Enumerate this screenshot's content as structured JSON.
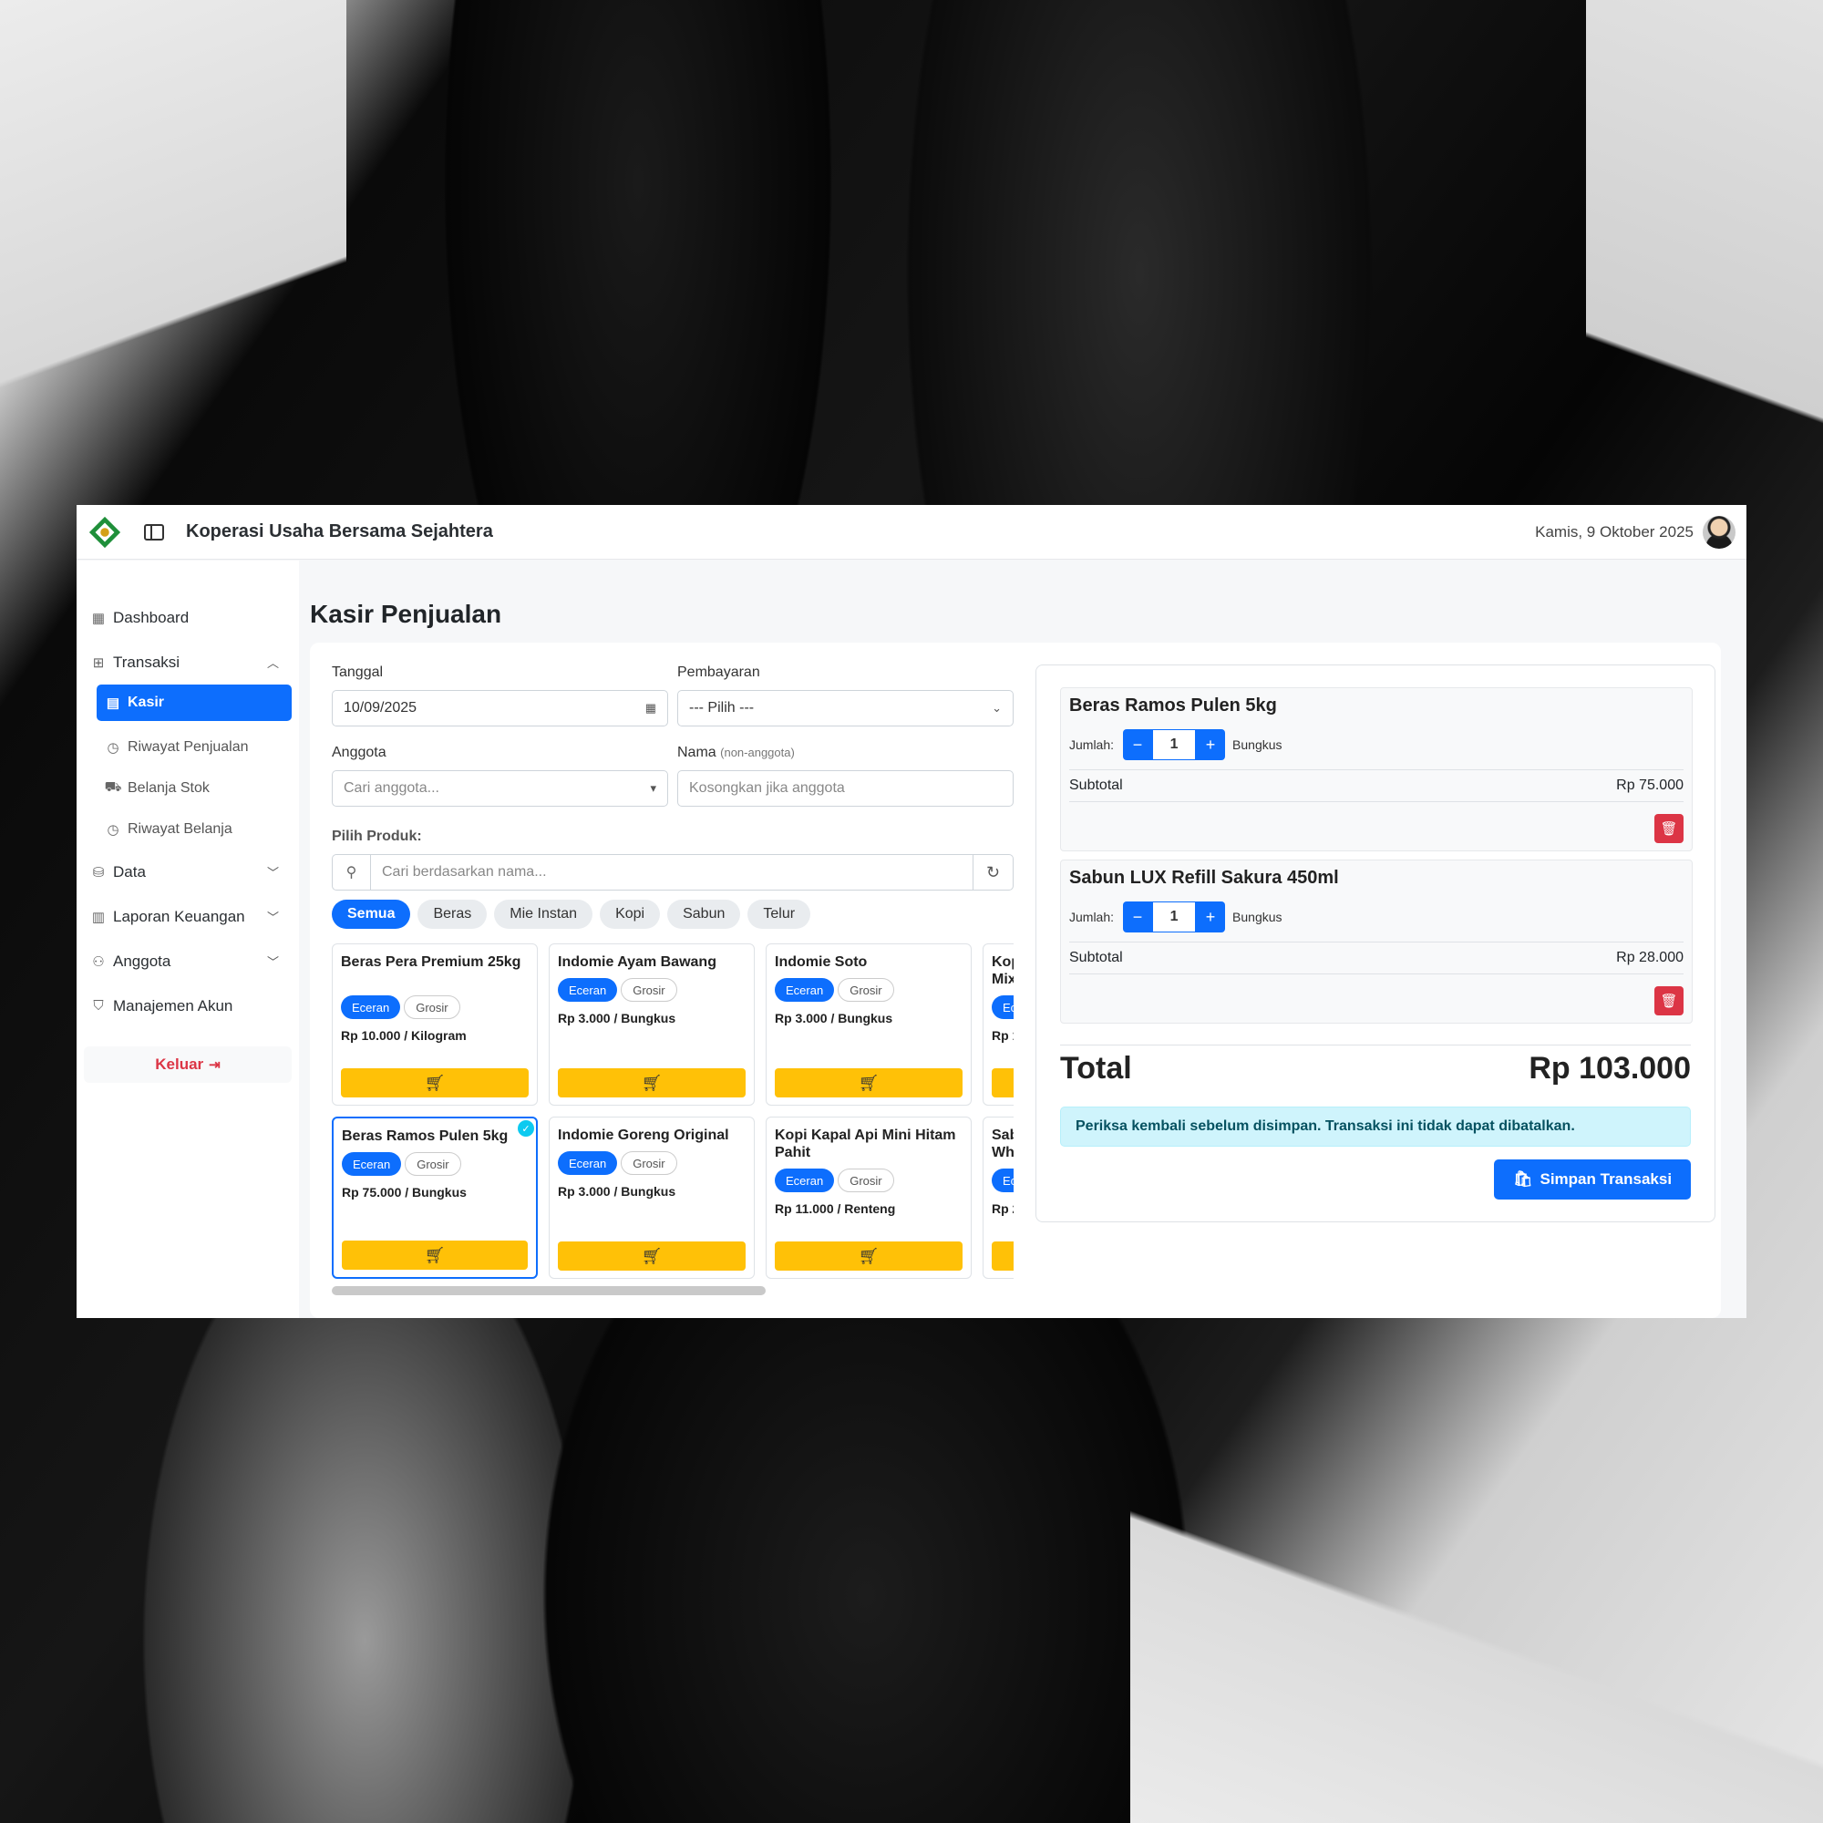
{
  "header": {
    "app_title": "Koperasi Usaha Bersama Sejahtera",
    "date": "Kamis, 9 Oktober 2025"
  },
  "sidebar": {
    "dashboard": "Dashboard",
    "transaksi": "Transaksi",
    "kasir": "Kasir",
    "riwayat_penjualan": "Riwayat Penjualan",
    "belanja_stok": "Belanja Stok",
    "riwayat_belanja": "Riwayat Belanja",
    "data": "Data",
    "laporan": "Laporan Keuangan",
    "anggota": "Anggota",
    "manajemen": "Manajemen Akun",
    "logout": "Keluar"
  },
  "page": {
    "title": "Kasir Penjualan"
  },
  "form": {
    "tanggal_label": "Tanggal",
    "tanggal_value": "10/09/2025",
    "pembayaran_label": "Pembayaran",
    "pembayaran_value": "--- Pilih ---",
    "anggota_label": "Anggota",
    "anggota_placeholder": "Cari anggota...",
    "nama_label": "Nama",
    "nama_hint": "(non-anggota)",
    "nama_placeholder": "Kosongkan jika anggota",
    "pilih_produk": "Pilih Produk:",
    "search_placeholder": "Cari berdasarkan nama..."
  },
  "categories": [
    "Semua",
    "Beras",
    "Mie Instan",
    "Kopi",
    "Sabun",
    "Telur"
  ],
  "badges": {
    "eceran": "Eceran",
    "grosir": "Grosir"
  },
  "products": [
    {
      "name": "Beras Pera Premium 25kg",
      "price": "Rp 10.000 / Kilogram"
    },
    {
      "name": "Indomie Ayam Bawang",
      "price": "Rp 3.000 / Bungkus"
    },
    {
      "name": "Indomie Soto",
      "price": "Rp 3.000 / Bungkus"
    },
    {
      "name": "Kop\nMix",
      "price": "Rp 1"
    },
    {
      "name": "Beras Ramos Pulen 5kg",
      "price": "Rp 75.000 / Bungkus"
    },
    {
      "name": "Indomie Goreng Original",
      "price": "Rp 3.000 / Bungkus"
    },
    {
      "name": "Kopi Kapal Api Mini Hitam Pahit",
      "price": "Rp 11.000 / Renteng"
    },
    {
      "name": "Sab\nWh",
      "price": "Rp 2"
    }
  ],
  "cart": {
    "items": [
      {
        "name": "Beras Ramos Pulen 5kg",
        "qty_label": "Jumlah:",
        "qty": "1",
        "unit": "Bungkus",
        "subtotal_label": "Subtotal",
        "subtotal": "Rp 75.000"
      },
      {
        "name": "Sabun LUX Refill Sakura 450ml",
        "qty_label": "Jumlah:",
        "qty": "1",
        "unit": "Bungkus",
        "subtotal_label": "Subtotal",
        "subtotal": "Rp 28.000"
      }
    ],
    "total_label": "Total",
    "total_value": "Rp 103.000",
    "alert": "Periksa kembali sebelum disimpan. Transaksi ini tidak dapat dibatalkan.",
    "save_label": "Simpan Transaksi"
  }
}
